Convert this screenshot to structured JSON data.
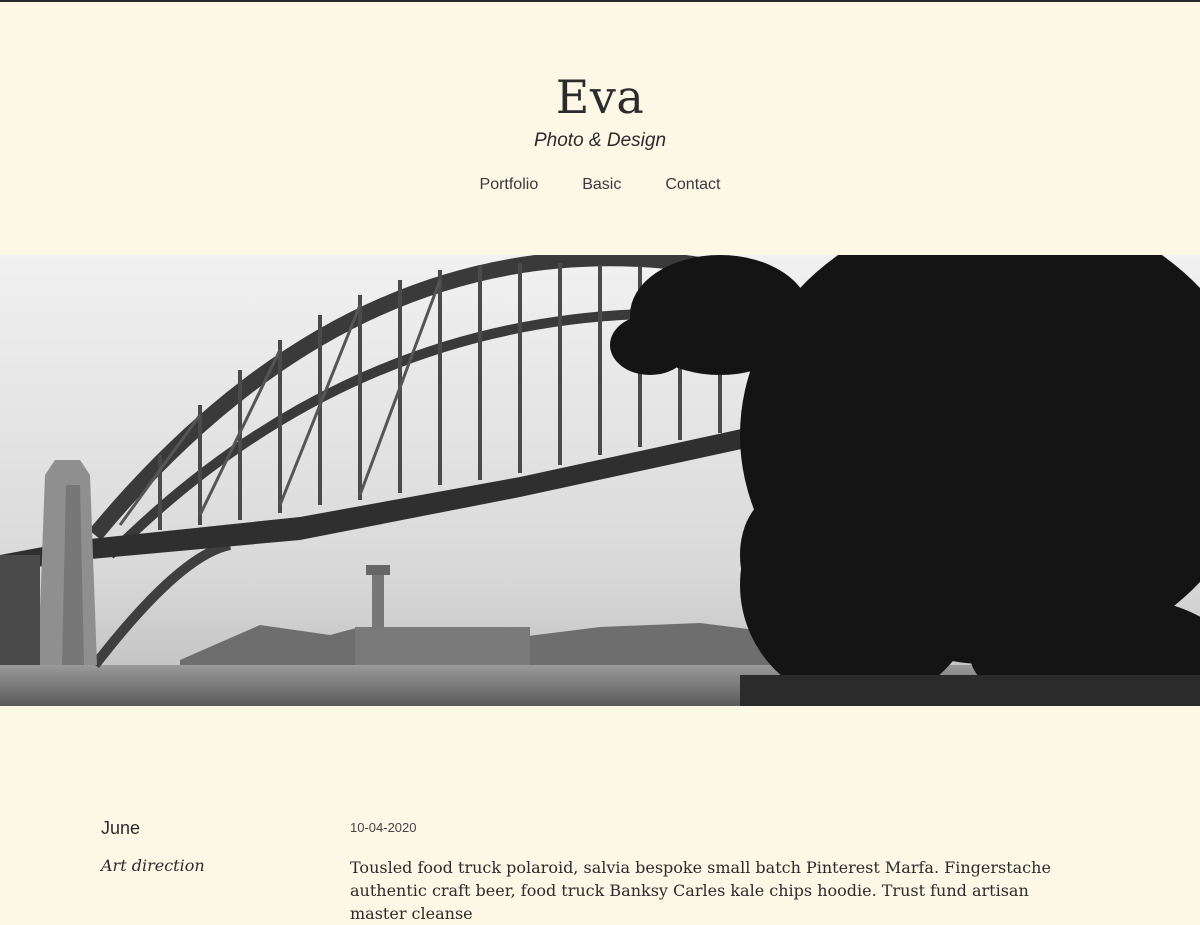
{
  "site": {
    "title": "Eva",
    "tagline": "Photo & Design"
  },
  "nav": {
    "items": [
      "Portfolio",
      "Basic",
      "Contact"
    ]
  },
  "post": {
    "author": "June",
    "category": "Art direction",
    "date": "10-04-2020",
    "excerpt": "Tousled food truck polaroid, salvia bespoke small batch Pinterest Marfa. Fingerstache authentic craft beer, food truck Banksy Carles kale chips hoodie. Trust fund artisan master cleanse"
  },
  "colors": {
    "background": "#fdf7e6",
    "text": "#2b2b2b"
  }
}
